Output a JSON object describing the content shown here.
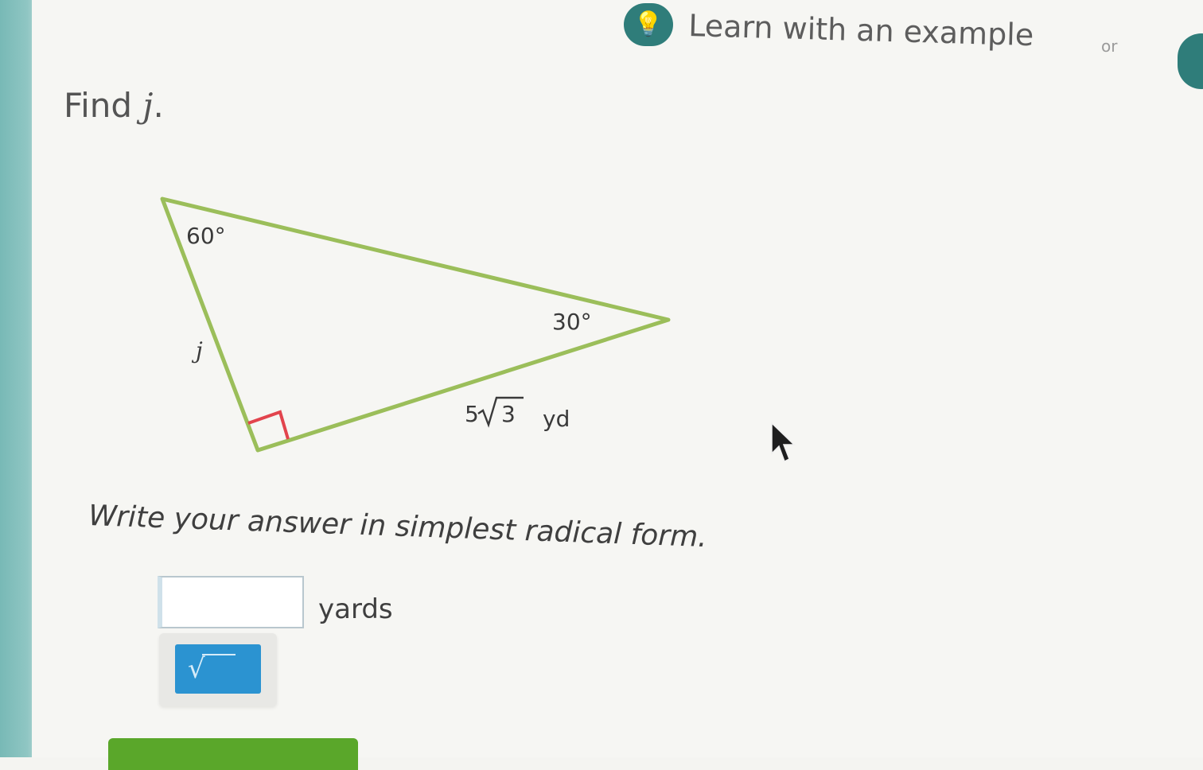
{
  "header": {
    "learn_icon_glyph": "💡",
    "learn_label": "Learn with an example",
    "or_label": "or"
  },
  "question": {
    "prompt_prefix": "Find ",
    "prompt_variable": "j",
    "prompt_suffix": "."
  },
  "diagram": {
    "angle_top": "60°",
    "angle_right": "30°",
    "side_label": "j",
    "hyp_coefficient": "5",
    "hyp_radicand": "3",
    "hyp_unit": "yd",
    "stroke_color": "#9bbe5a",
    "right_angle_color": "#e2444d"
  },
  "answer": {
    "instruction": "Write your answer in simplest radical form.",
    "input_value": "",
    "unit": "yards",
    "sqrt_button_glyph": "√"
  },
  "colors": {
    "accent_teal": "#2f7d7a",
    "keypad_blue": "#2b93d1",
    "submit_green": "#5aa72a"
  }
}
